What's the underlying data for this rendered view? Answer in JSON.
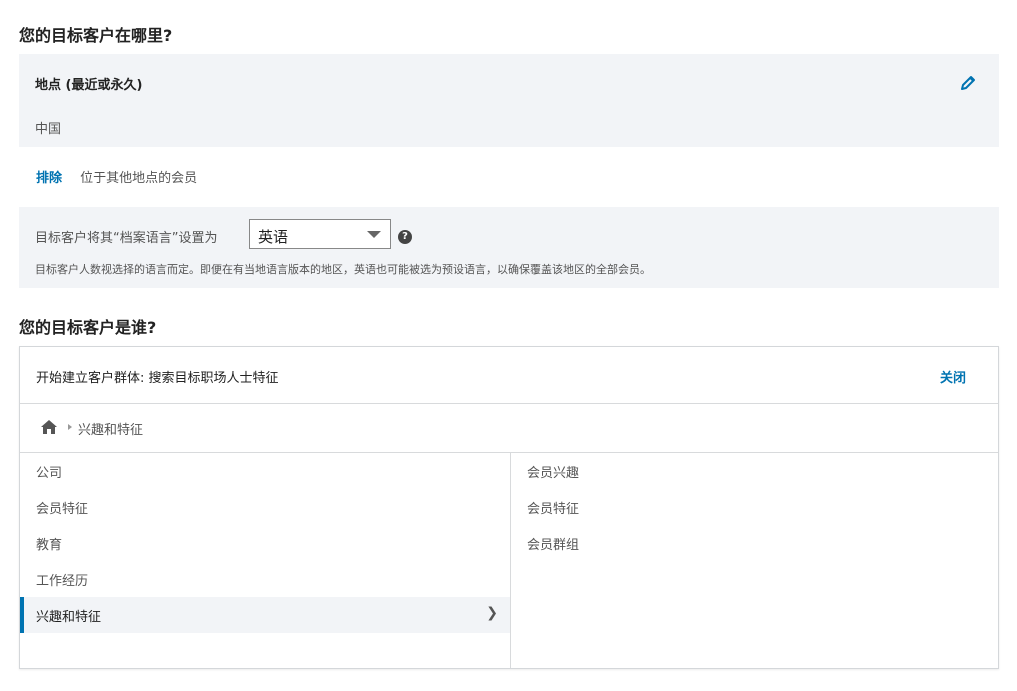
{
  "location_section": {
    "heading": "您的目标客户在哪里?",
    "location_label": "地点 (最近或永久)",
    "location_value": "中国",
    "exclude_link": "排除",
    "exclude_text": "位于其他地点的会员",
    "language_prefix": "目标客户将其“档案语言”设置为",
    "language_value": "英语",
    "language_note": "目标客户人数视选择的语言而定。即便在有当地语言版本的地区，英语也可能被选为预设语言，以确保覆盖该地区的全部会员。"
  },
  "audience_section": {
    "heading": "您的目标客户是谁?",
    "panel_title": "开始建立客户群体: 搜索目标职场人士特征",
    "close_label": "关闭",
    "breadcrumb": "兴趣和特征",
    "left_items": [
      {
        "label": "公司"
      },
      {
        "label": "会员特征"
      },
      {
        "label": "教育"
      },
      {
        "label": "工作经历"
      },
      {
        "label": "兴趣和特征"
      }
    ],
    "right_items": [
      {
        "label": "会员兴趣"
      },
      {
        "label": "会员特征"
      },
      {
        "label": "会员群组"
      }
    ]
  },
  "colors": {
    "accent": "#0073b1",
    "panel_bg": "#f2f4f7"
  },
  "icons": {
    "edit": "pencil-icon",
    "help": "help-icon",
    "home": "home-icon",
    "chevron": "chevron-right-icon"
  }
}
